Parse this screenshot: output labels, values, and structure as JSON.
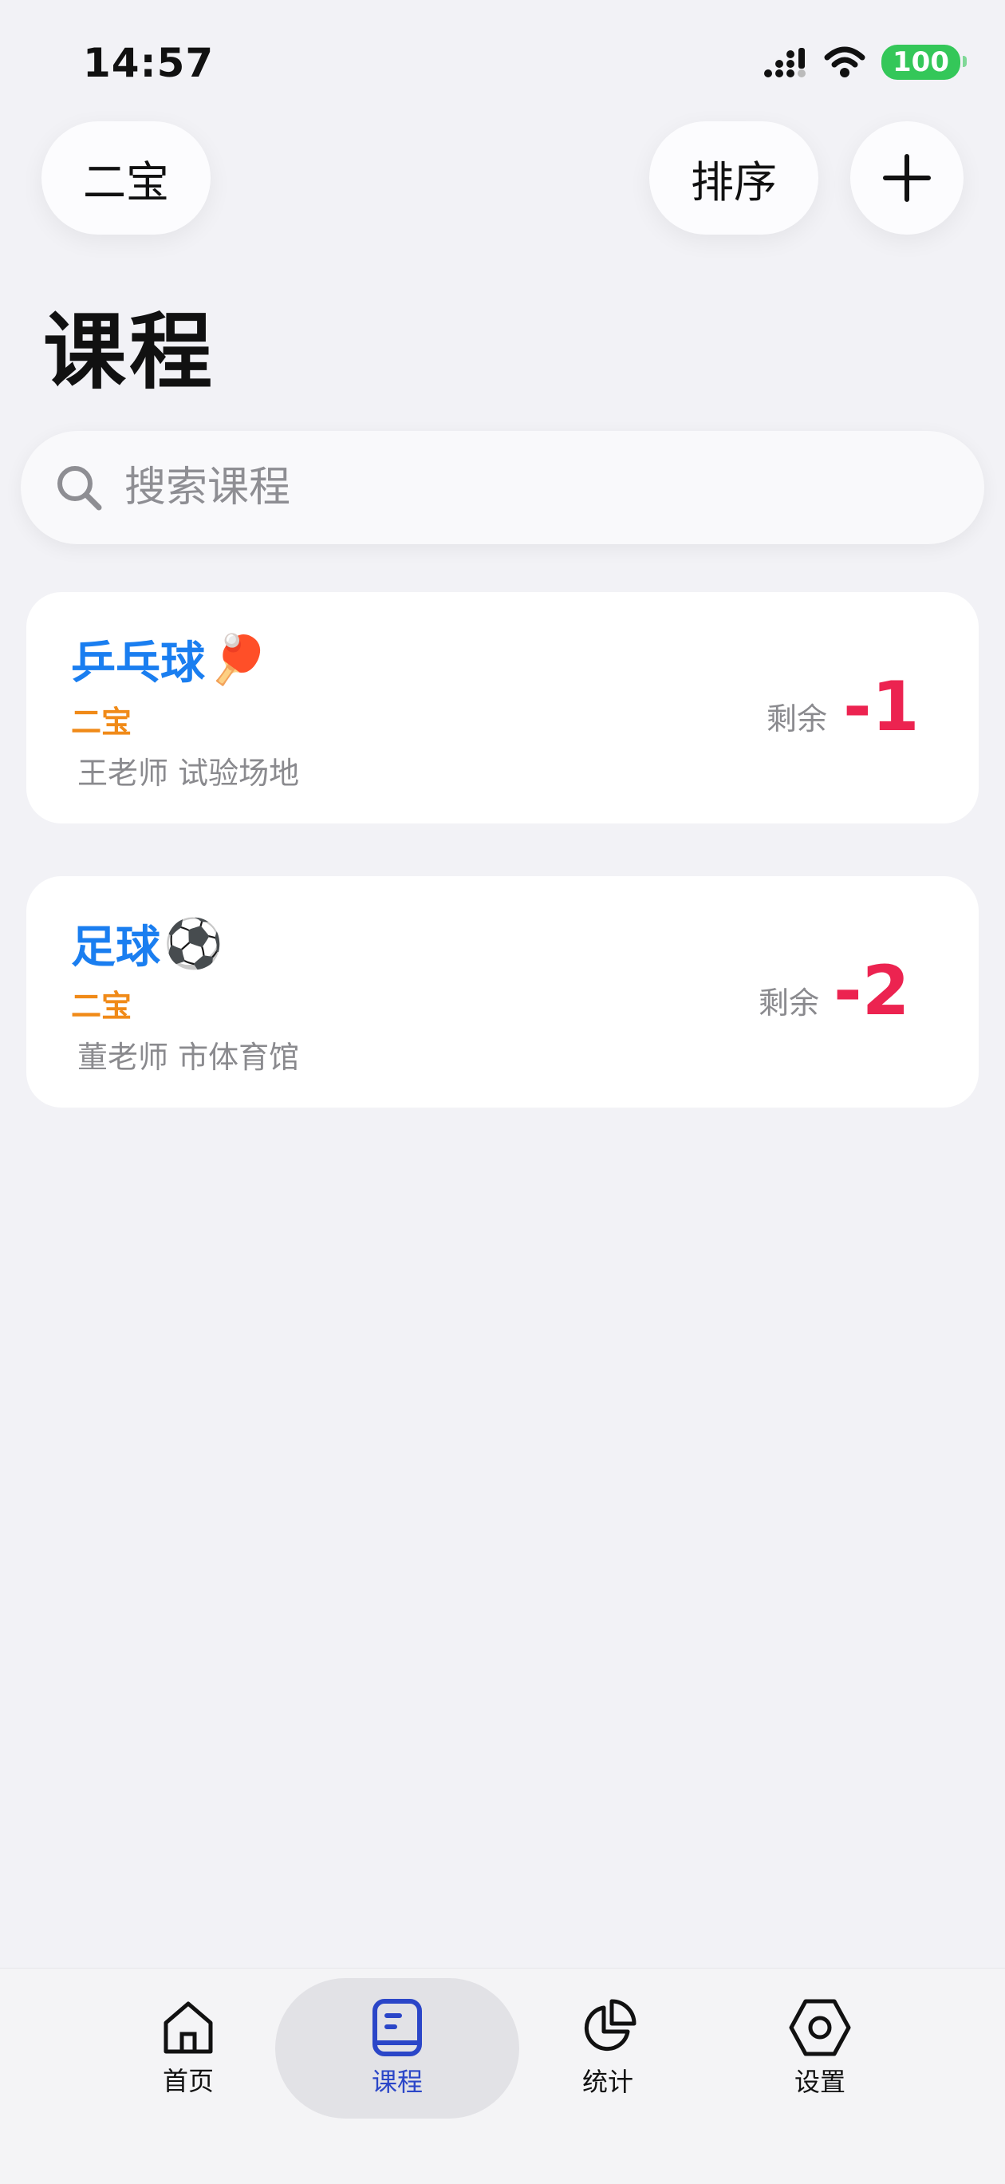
{
  "status_bar": {
    "time": "14:57",
    "battery": "100"
  },
  "header": {
    "user_label": "二宝",
    "sort_label": "排序",
    "add_label": "+"
  },
  "page_title": "课程",
  "search": {
    "placeholder": "搜索课程",
    "value": ""
  },
  "courses": [
    {
      "title": "乒乓球",
      "emoji": "🏓",
      "owner": "二宝",
      "meta": "王老师 试验场地",
      "remain_label": "剩余",
      "remain_value": "-1"
    },
    {
      "title": "足球",
      "emoji": "⚽",
      "owner": "二宝",
      "meta": "董老师 市体育馆",
      "remain_label": "剩余",
      "remain_value": "-2"
    }
  ],
  "tabbar": {
    "items": [
      {
        "label": "首页",
        "icon": "home-icon"
      },
      {
        "label": "课程",
        "icon": "book-icon",
        "active": true
      },
      {
        "label": "统计",
        "icon": "pie-chart-icon"
      },
      {
        "label": "设置",
        "icon": "settings-hexagon-icon"
      }
    ]
  },
  "colors": {
    "accent_blue": "#1a7ef0",
    "owner_orange": "#f08a18",
    "remain_red": "#ec2350",
    "active_tab": "#2b46c8",
    "background": "#f2f2f6"
  }
}
